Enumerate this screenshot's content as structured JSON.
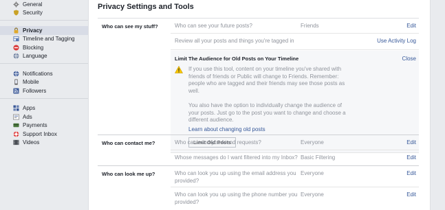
{
  "sidebar": {
    "groups": [
      [
        {
          "label": "General",
          "icon": "gear-icon"
        },
        {
          "label": "Security",
          "icon": "shield-icon"
        }
      ],
      [
        {
          "label": "Privacy",
          "icon": "lock-icon",
          "active": true
        },
        {
          "label": "Timeline and Tagging",
          "icon": "timeline-icon"
        },
        {
          "label": "Blocking",
          "icon": "block-icon"
        },
        {
          "label": "Language",
          "icon": "globe-icon"
        }
      ],
      [
        {
          "label": "Notifications",
          "icon": "notification-globe-icon"
        },
        {
          "label": "Mobile",
          "icon": "mobile-icon"
        },
        {
          "label": "Followers",
          "icon": "rss-icon"
        }
      ],
      [
        {
          "label": "Apps",
          "icon": "apps-icon"
        },
        {
          "label": "Ads",
          "icon": "ads-icon"
        },
        {
          "label": "Payments",
          "icon": "payments-icon"
        },
        {
          "label": "Support Inbox",
          "icon": "support-icon"
        },
        {
          "label": "Videos",
          "icon": "videos-icon"
        }
      ]
    ]
  },
  "main": {
    "title": "Privacy Settings and Tools",
    "sections": {
      "stuff": {
        "label": "Who can see my stuff?",
        "rows": [
          {
            "desc": "Who can see your future posts?",
            "value": "Friends",
            "action": "Edit"
          },
          {
            "desc": "Review all your posts and things you're tagged in",
            "value": "",
            "action": "Use Activity Log"
          }
        ],
        "expanded": {
          "title": "Limit The Audience for Old Posts on Your Timeline",
          "close": "Close",
          "para1": "If you use this tool, content on your timeline you've shared with friends of friends or Public will change to Friends. Remember: people who are tagged and their friends may see those posts as well.",
          "para2": "You also have the option to individually change the audience of your posts. Just go to the post you want to change and choose a different audience.",
          "link": "Learn about changing old posts",
          "button": "Limit Old Posts"
        }
      },
      "contact": {
        "label": "Who can contact me?",
        "rows": [
          {
            "desc": "Who can send you friend requests?",
            "value": "Everyone",
            "action": "Edit"
          },
          {
            "desc": "Whose messages do I want filtered into my Inbox?",
            "value": "Basic Filtering",
            "action": "Edit"
          }
        ]
      },
      "lookup": {
        "label": "Who can look me up?",
        "rows": [
          {
            "desc": "Who can look you up using the email address you provided?",
            "value": "Everyone",
            "action": "Edit"
          },
          {
            "desc": "Who can look you up using the phone number you provided?",
            "value": "Everyone",
            "action": "Edit"
          }
        ]
      }
    }
  },
  "colors": {
    "link": "#365899",
    "muted": "#90949c",
    "warning": "#f7c600"
  }
}
